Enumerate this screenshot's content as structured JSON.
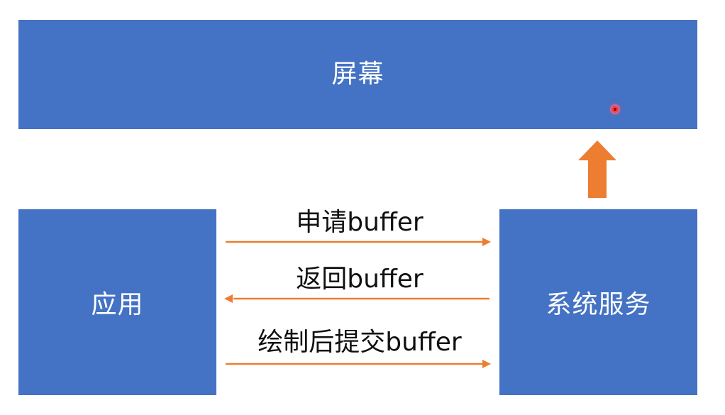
{
  "boxes": {
    "screen": "屏幕",
    "app": "应用",
    "service": "系统服务"
  },
  "messages": {
    "request_buffer": "申请buffer",
    "return_buffer": "返回buffer",
    "submit_buffer": "绘制后提交buffer"
  },
  "colors": {
    "box": "#4472C4",
    "arrow": "#ED7D31",
    "up_arrow": "#ED7D31",
    "box_text": "#FFFFFF",
    "label_text": "#111111"
  }
}
